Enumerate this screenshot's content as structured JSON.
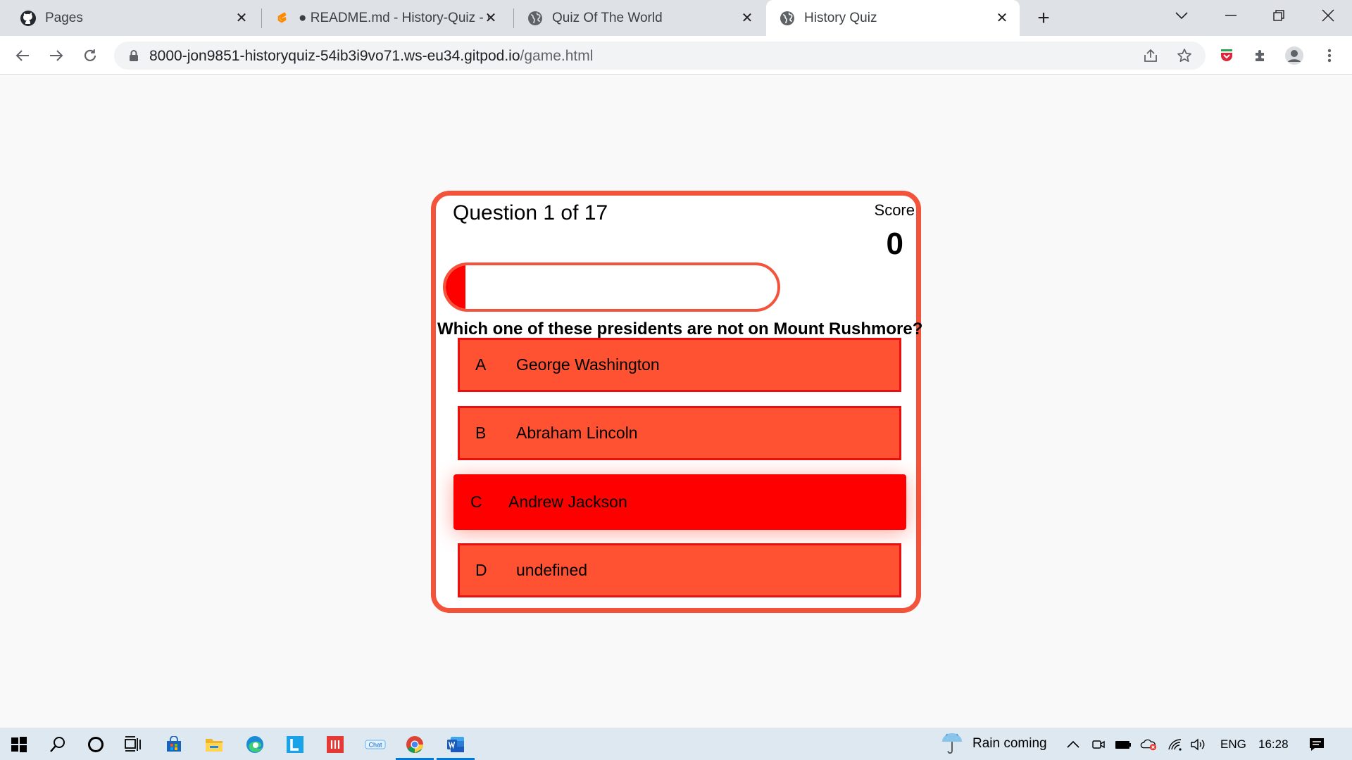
{
  "browser": {
    "tabs": [
      {
        "title": "Pages",
        "icon": "github-icon",
        "active": false
      },
      {
        "title": "● README.md - History-Quiz - G",
        "icon": "gitpod-icon",
        "active": false
      },
      {
        "title": "Quiz Of The World",
        "icon": "globe-icon",
        "active": false
      },
      {
        "title": "History Quiz",
        "icon": "globe-icon",
        "active": true
      }
    ],
    "close_glyph": "✕",
    "new_tab_glyph": "+",
    "url_host": "8000-jon9851-historyquiz-54ib3i9vo71.ws-eu34.gitpod.io",
    "url_path": "/game.html"
  },
  "quiz": {
    "question_count": "Question 1 of 17",
    "score_label": "Score",
    "score_value": "0",
    "progress": 0.0588,
    "question": "Which one of these presidents are not on Mount Rushmore?",
    "choices": [
      {
        "prefix": "A",
        "text": "George Washington"
      },
      {
        "prefix": "B",
        "text": "Abraham Lincoln"
      },
      {
        "prefix": "C",
        "text": "Andrew Jackson"
      },
      {
        "prefix": "D",
        "text": "undefined"
      }
    ],
    "colors": {
      "border": "#f4533b",
      "choice": "#ff5233",
      "choice_hover": "#ff0000",
      "progress": "#ff0000"
    }
  },
  "taskbar": {
    "apps": [
      "windows-start-icon",
      "search-icon",
      "cortana-icon",
      "task-view-icon",
      "store-icon",
      "file-explorer-icon",
      "edge-icon",
      "l-app-icon",
      "red-app-icon",
      "chat-app-icon",
      "chrome-icon",
      "word-icon"
    ],
    "weather": "Rain coming",
    "language": "ENG",
    "time": "16:28"
  }
}
